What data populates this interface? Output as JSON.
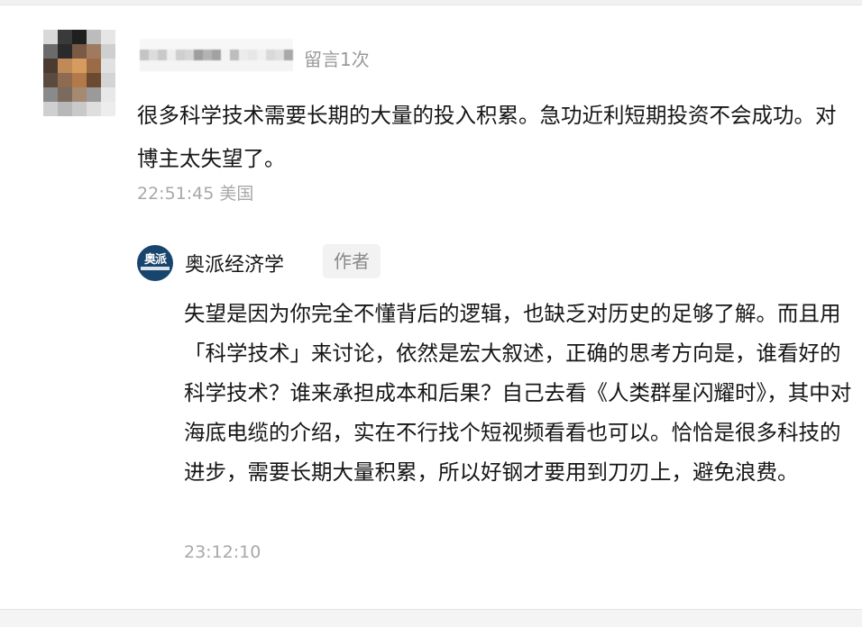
{
  "comment": {
    "count_label": "留言1次",
    "text": "很多科学技术需要长期的大量的投入积累。急功近利短期投资不会成功。对博主太失望了。",
    "time": "22:51:45",
    "location": "美国"
  },
  "reply": {
    "author_name": "奥派经济学",
    "author_badge": "作者",
    "logo_text": "奥派",
    "text": "失望是因为你完全不懂背后的逻辑，也缺乏对历史的足够了解。而且用「科学技术」来讨论，依然是宏大叙述，正确的思考方向是，谁看好的科学技术？谁来承担成本和后果？自己去看《人类群星闪耀时》，其中对海底电缆的介绍，实在不行找个短视频看看也可以。恰恰是很多科技的进步，需要长期大量积累，所以好钢才要用到刀刃上，避免浪费。",
    "time": "23:12:10"
  },
  "icons": {
    "commenter_avatar": "blurred-avatar",
    "author_logo": "aopai-logo-icon"
  },
  "colors": {
    "logo_bg": "#17456d",
    "meta_text": "#a8a8a8",
    "badge_bg": "#f2f2f2"
  }
}
